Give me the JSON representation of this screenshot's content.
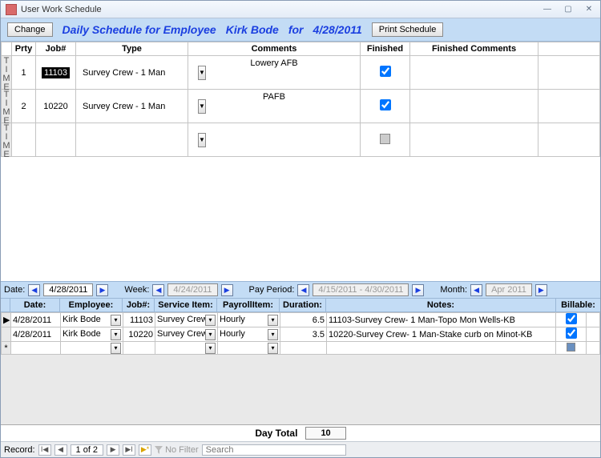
{
  "window": {
    "title": "User Work Schedule"
  },
  "header": {
    "change_btn": "Change",
    "title_label": "Daily Schedule for Employee",
    "employee_name": "Kirk Bode",
    "for_label": "for",
    "date": "4/28/2011",
    "print_btn": "Print Schedule"
  },
  "upper_cols": {
    "prty": "Prty",
    "job": "Job#",
    "type": "Type",
    "comments": "Comments",
    "finished": "Finished",
    "fin_comments": "Finished Comments"
  },
  "upper_rows": [
    {
      "time": "TIME",
      "prty": "1",
      "job": "11103",
      "job_highlight": true,
      "type": "Survey Crew - 1 Man",
      "comments": "Lowery AFB",
      "finished": true
    },
    {
      "time": "TIME",
      "prty": "2",
      "job": "10220",
      "job_highlight": false,
      "type": "Survey Crew - 1 Man",
      "comments": "PAFB",
      "finished": true
    },
    {
      "time": "TIME",
      "prty": "",
      "job": "",
      "job_highlight": false,
      "type": "",
      "comments": "",
      "finished": null
    }
  ],
  "nav": {
    "date_lbl": "Date:",
    "date_val": "4/28/2011",
    "week_lbl": "Week:",
    "week_val": "4/24/2011",
    "period_lbl": "Pay Period:",
    "period_val": "4/15/2011 - 4/30/2011",
    "month_lbl": "Month:",
    "month_val": "Apr 2011"
  },
  "lower_cols": {
    "date": "Date:",
    "employee": "Employee:",
    "job": "Job#:",
    "service": "Service Item:",
    "payroll": "PayrollItem:",
    "duration": "Duration:",
    "notes": "Notes:",
    "billable": "Billable:"
  },
  "lower_rows": [
    {
      "marker": "▶",
      "date": "4/28/2011",
      "employee": "Kirk Bode",
      "job": "11103",
      "service": "Survey Crew-",
      "payroll": "Hourly",
      "duration": "6.5",
      "notes": "11103-Survey Crew- 1 Man-Topo Mon Wells-KB",
      "billable": true
    },
    {
      "marker": "",
      "date": "4/28/2011",
      "employee": "Kirk Bode",
      "job": "10220",
      "service": "Survey Crew-",
      "payroll": "Hourly",
      "duration": "3.5",
      "notes": "10220-Survey Crew- 1 Man-Stake curb on Minot-KB",
      "billable": true
    },
    {
      "marker": "*",
      "date": "",
      "employee": "",
      "job": "",
      "service": "",
      "payroll": "",
      "duration": "",
      "notes": "",
      "billable": null
    }
  ],
  "total": {
    "label": "Day Total",
    "value": "10"
  },
  "record": {
    "label": "Record:",
    "pos": "1 of 2",
    "filter": "No Filter",
    "search": "Search"
  }
}
